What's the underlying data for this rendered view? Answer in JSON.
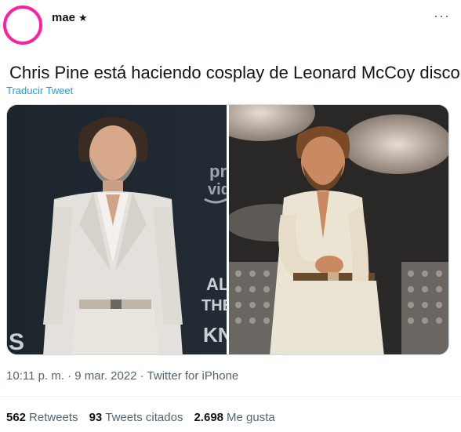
{
  "author": {
    "name": "mae",
    "badge": "★"
  },
  "menu": {
    "more": "···"
  },
  "tweet": {
    "text": "Chris Pine está haciendo cosplay de Leonard McCoy disco.",
    "translate_label": "Traducir Tweet"
  },
  "media": {
    "left_sign_text": [
      "pri",
      "vid",
      "ALL",
      "THE O",
      "KNI",
      "S"
    ]
  },
  "meta": {
    "timestamp": "10:11 p. m. · 9 mar. 2022 · Twitter for iPhone"
  },
  "stats": {
    "retweets": {
      "count": "562",
      "label": "Retweets"
    },
    "quotes": {
      "count": "93",
      "label": "Tweets citados"
    },
    "likes": {
      "count": "2.698",
      "label": "Me gusta"
    }
  },
  "colors": {
    "accent": "#1d9bf0",
    "avatar_ring": "#ff1fa0",
    "muted": "#536471"
  }
}
